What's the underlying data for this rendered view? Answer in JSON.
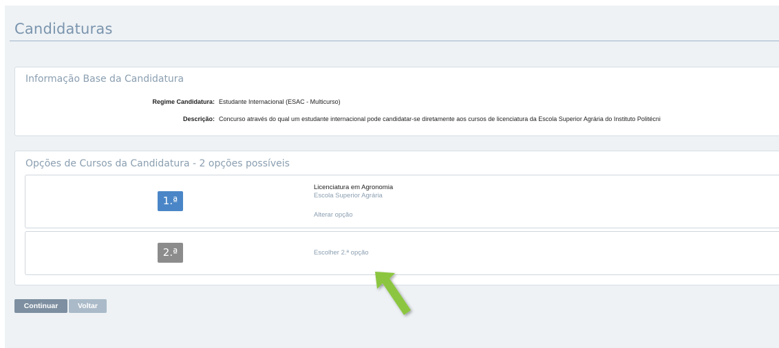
{
  "page": {
    "title": "Candidaturas"
  },
  "base_info": {
    "title": "Informação Base da Candidatura",
    "rows": [
      {
        "label": "Regime Candidatura:",
        "value": "Estudante Internacional (ESAC - Multicurso)"
      },
      {
        "label": "Descrição:",
        "value": "Concurso através do qual um estudante internacional pode candidatar-se diretamente aos cursos de licenciatura da Escola Superior Agrária do Instituto Politécni"
      }
    ]
  },
  "course_options": {
    "title": "Opções de Cursos da Candidatura - 2 opções possíveis",
    "options": [
      {
        "number": "1.ª",
        "course": "Licenciatura em Agronomia",
        "school": "Escola Superior Agrária",
        "link": "Alterar opção"
      },
      {
        "number": "2.ª",
        "link": "Escolher 2.ª opção"
      }
    ]
  },
  "actions": {
    "continue_label": "Continuar",
    "back_label": "Voltar"
  },
  "colors": {
    "badge_active": "#4a86c7",
    "badge_inactive": "#8c8c8c",
    "arrow": "#8cc63f"
  },
  "annotation": {
    "arrow_icon": "green-pointer-arrow-icon"
  }
}
